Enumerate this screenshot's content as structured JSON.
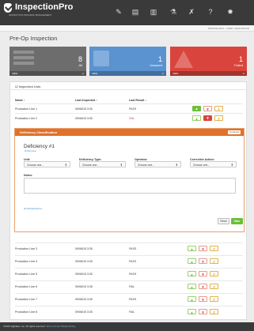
{
  "brand": {
    "name": "InspectionPro",
    "tagline": "INSPECTION PROCESS MANAGEMENT"
  },
  "nav": {
    "icons": [
      "edit-icon",
      "document-icon",
      "bar-chart-icon",
      "beaker-icon",
      "wrench-icon",
      "help-icon",
      "gear-icon"
    ]
  },
  "subbar": {
    "links": "PRIVATE DATA  ·  USER: ADAM WOOD"
  },
  "page": {
    "title": "Pre-Op Inspection"
  },
  "cards": [
    {
      "count": "8",
      "label": "All",
      "foot": "VIEW",
      "color": "#6d6d6d"
    },
    {
      "count": "1",
      "label": "Unsaved",
      "foot": "VIEW",
      "color": "#5b93d0"
    },
    {
      "count": "1",
      "label": "Failed",
      "foot": "VIEW",
      "color": "#d9453c"
    }
  ],
  "panel": {
    "title": "Inspection Lists"
  },
  "table": {
    "headers": [
      "Name ↕",
      "Last Inspected ↕",
      "Last Result ↕"
    ],
    "rows": [
      {
        "name": "Production Line 1",
        "date": "09/08/15 3:30",
        "result": "PASS",
        "result_color": "#444"
      },
      {
        "name": "Production Line 2",
        "date": "09/08/15 3:30",
        "result": "FAIL",
        "result_color": "#d9453c"
      },
      {
        "name": "Production Line 3",
        "date": "09/08/15 3:30",
        "result": "PASS",
        "result_color": "#444"
      },
      {
        "name": "Production Line 4",
        "date": "09/08/15 3:30",
        "result": "PASS",
        "result_color": "#444"
      },
      {
        "name": "Production Line 5",
        "date": "09/08/15 3:30",
        "result": "PASS",
        "result_color": "#444"
      },
      {
        "name": "Production Line 6",
        "date": "09/08/15 3:30",
        "result": "FAIL",
        "result_color": "#444"
      },
      {
        "name": "Production Line 7",
        "date": "09/08/15 3:30",
        "result": "PASS",
        "result_color": "#444"
      },
      {
        "name": "Production Line 8",
        "date": "09/08/15 3:30",
        "result": "FAIL",
        "result_color": "#444"
      }
    ]
  },
  "defect": {
    "header": "Deficiency Classification",
    "cancel": "Unsaved",
    "title": "Deficiency #1",
    "remove": "Remove",
    "fields": [
      {
        "label": "Unit:",
        "value": "Choose one..."
      },
      {
        "label": "Deficiency Type:",
        "value": "Choose one..."
      },
      {
        "label": "Operator:",
        "value": "Choose one..."
      },
      {
        "label": "Corrective Action:",
        "value": "Choose one..."
      }
    ],
    "notes_label": "Notes:",
    "notes_value": "",
    "add": "Add Deficiency",
    "reset": "Reset",
    "save": "Save"
  },
  "footer": {
    "copyright": "©2015 Highlake, Inc. All rights reserved.",
    "terms": "Terms of Use",
    "privacy": "Privacy Policy"
  }
}
